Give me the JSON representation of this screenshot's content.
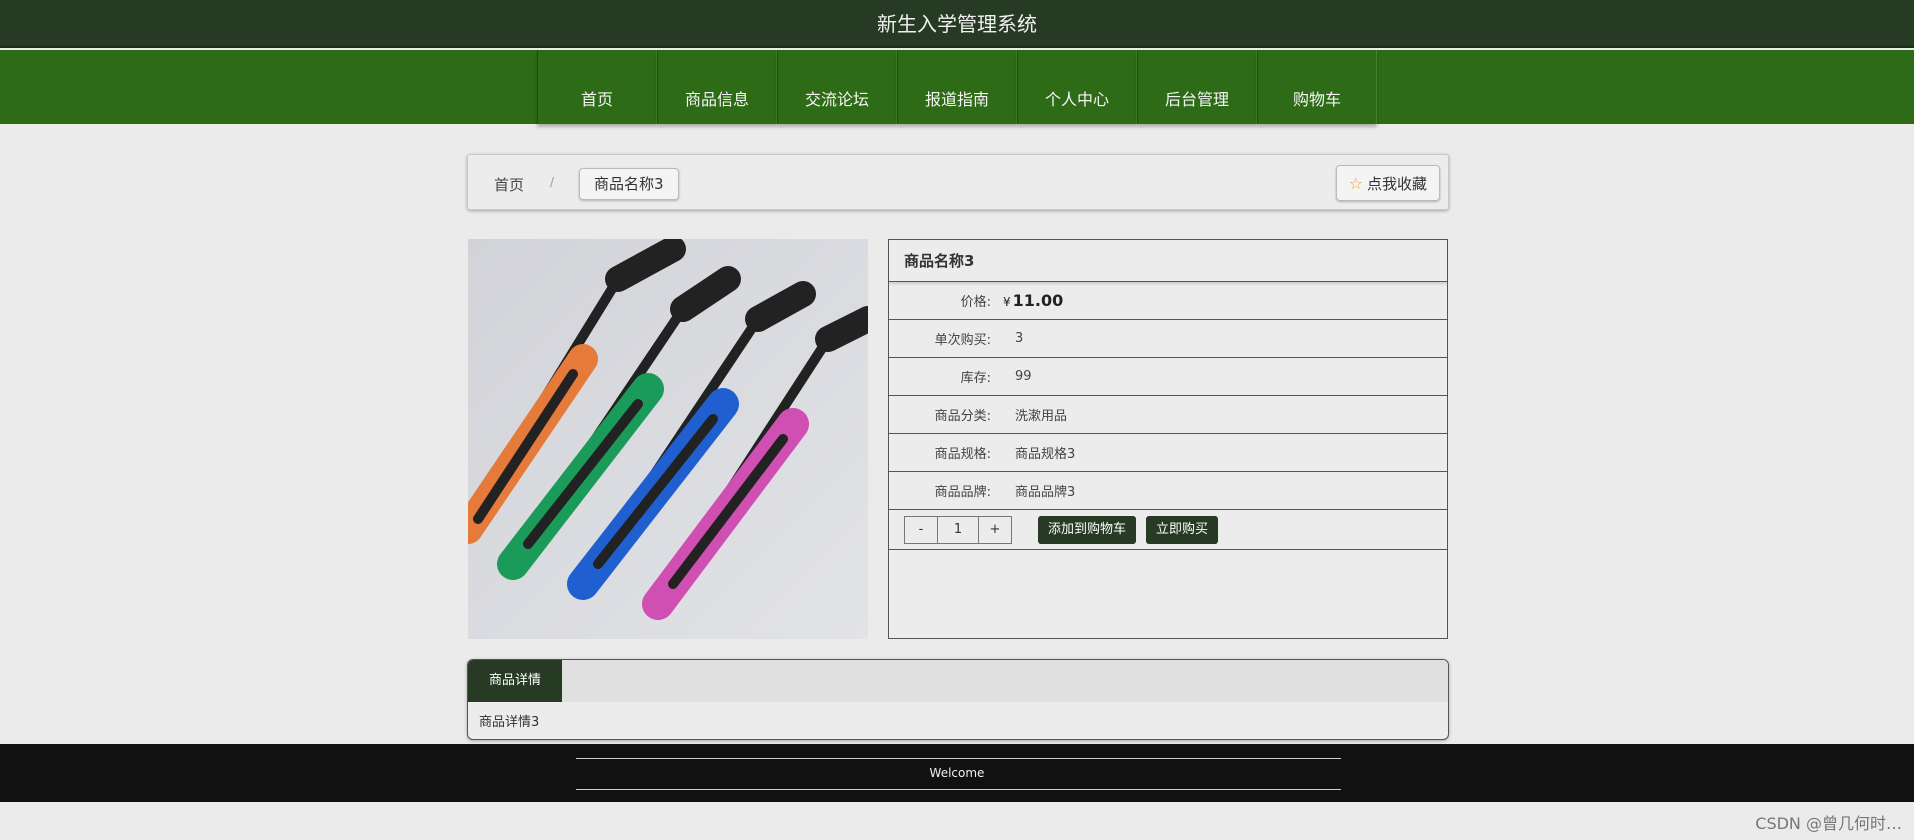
{
  "header": {
    "title": "新生入学管理系统"
  },
  "nav": {
    "items": [
      "首页",
      "商品信息",
      "交流论坛",
      "报道指南",
      "个人中心",
      "后台管理",
      "购物车"
    ]
  },
  "breadcrumb": {
    "home": "首页",
    "separator": "/",
    "current": "商品名称3",
    "favorite_button": "点我收藏"
  },
  "product": {
    "name": "商品名称3",
    "price_label": "价格:",
    "currency": "¥",
    "price": "11.00",
    "rows": [
      {
        "label": "单次购买:",
        "value": "3"
      },
      {
        "label": "库存:",
        "value": "99"
      },
      {
        "label": "商品分类:",
        "value": "洗漱用品"
      },
      {
        "label": "商品规格:",
        "value": "商品规格3"
      },
      {
        "label": "商品品牌:",
        "value": "商品品牌3"
      }
    ],
    "quantity": {
      "minus": "-",
      "value": "1",
      "plus": "+"
    },
    "add_to_cart": "添加到购物车",
    "buy_now": "立即购买"
  },
  "detail": {
    "tab_label": "商品详情",
    "content": "商品详情3"
  },
  "footer": {
    "text": "Welcome"
  },
  "watermark": "CSDN @曾几何时…",
  "colors": {
    "header_bg": "#263a24",
    "nav_bg": "#2e6b17",
    "button_dark": "#263a24",
    "footer_bg": "#111111",
    "page_bg": "#ebebeb"
  },
  "product_image": {
    "description_hidden": true,
    "brush_colors": [
      "#e57a3a",
      "#1a9b5a",
      "#1f5fd0",
      "#d04fb2"
    ]
  }
}
